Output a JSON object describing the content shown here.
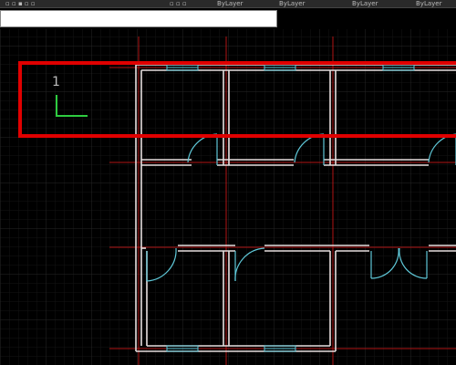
{
  "toolbar": {
    "layer_1": "ByLayer",
    "layer_2": "ByLayer",
    "layer_3": "ByLayer",
    "layer_4": "ByLayer"
  },
  "command_line": {
    "value": ""
  },
  "ucs": {
    "label": "1"
  },
  "colors": {
    "background": "#000000",
    "walls": "#e8e0e0",
    "axis_lines": "#c01818",
    "doors": "#5fc8d8",
    "windows": "#5fc8d8",
    "ucs_icon": "#2ecc40",
    "highlight_box": "#e00000"
  }
}
